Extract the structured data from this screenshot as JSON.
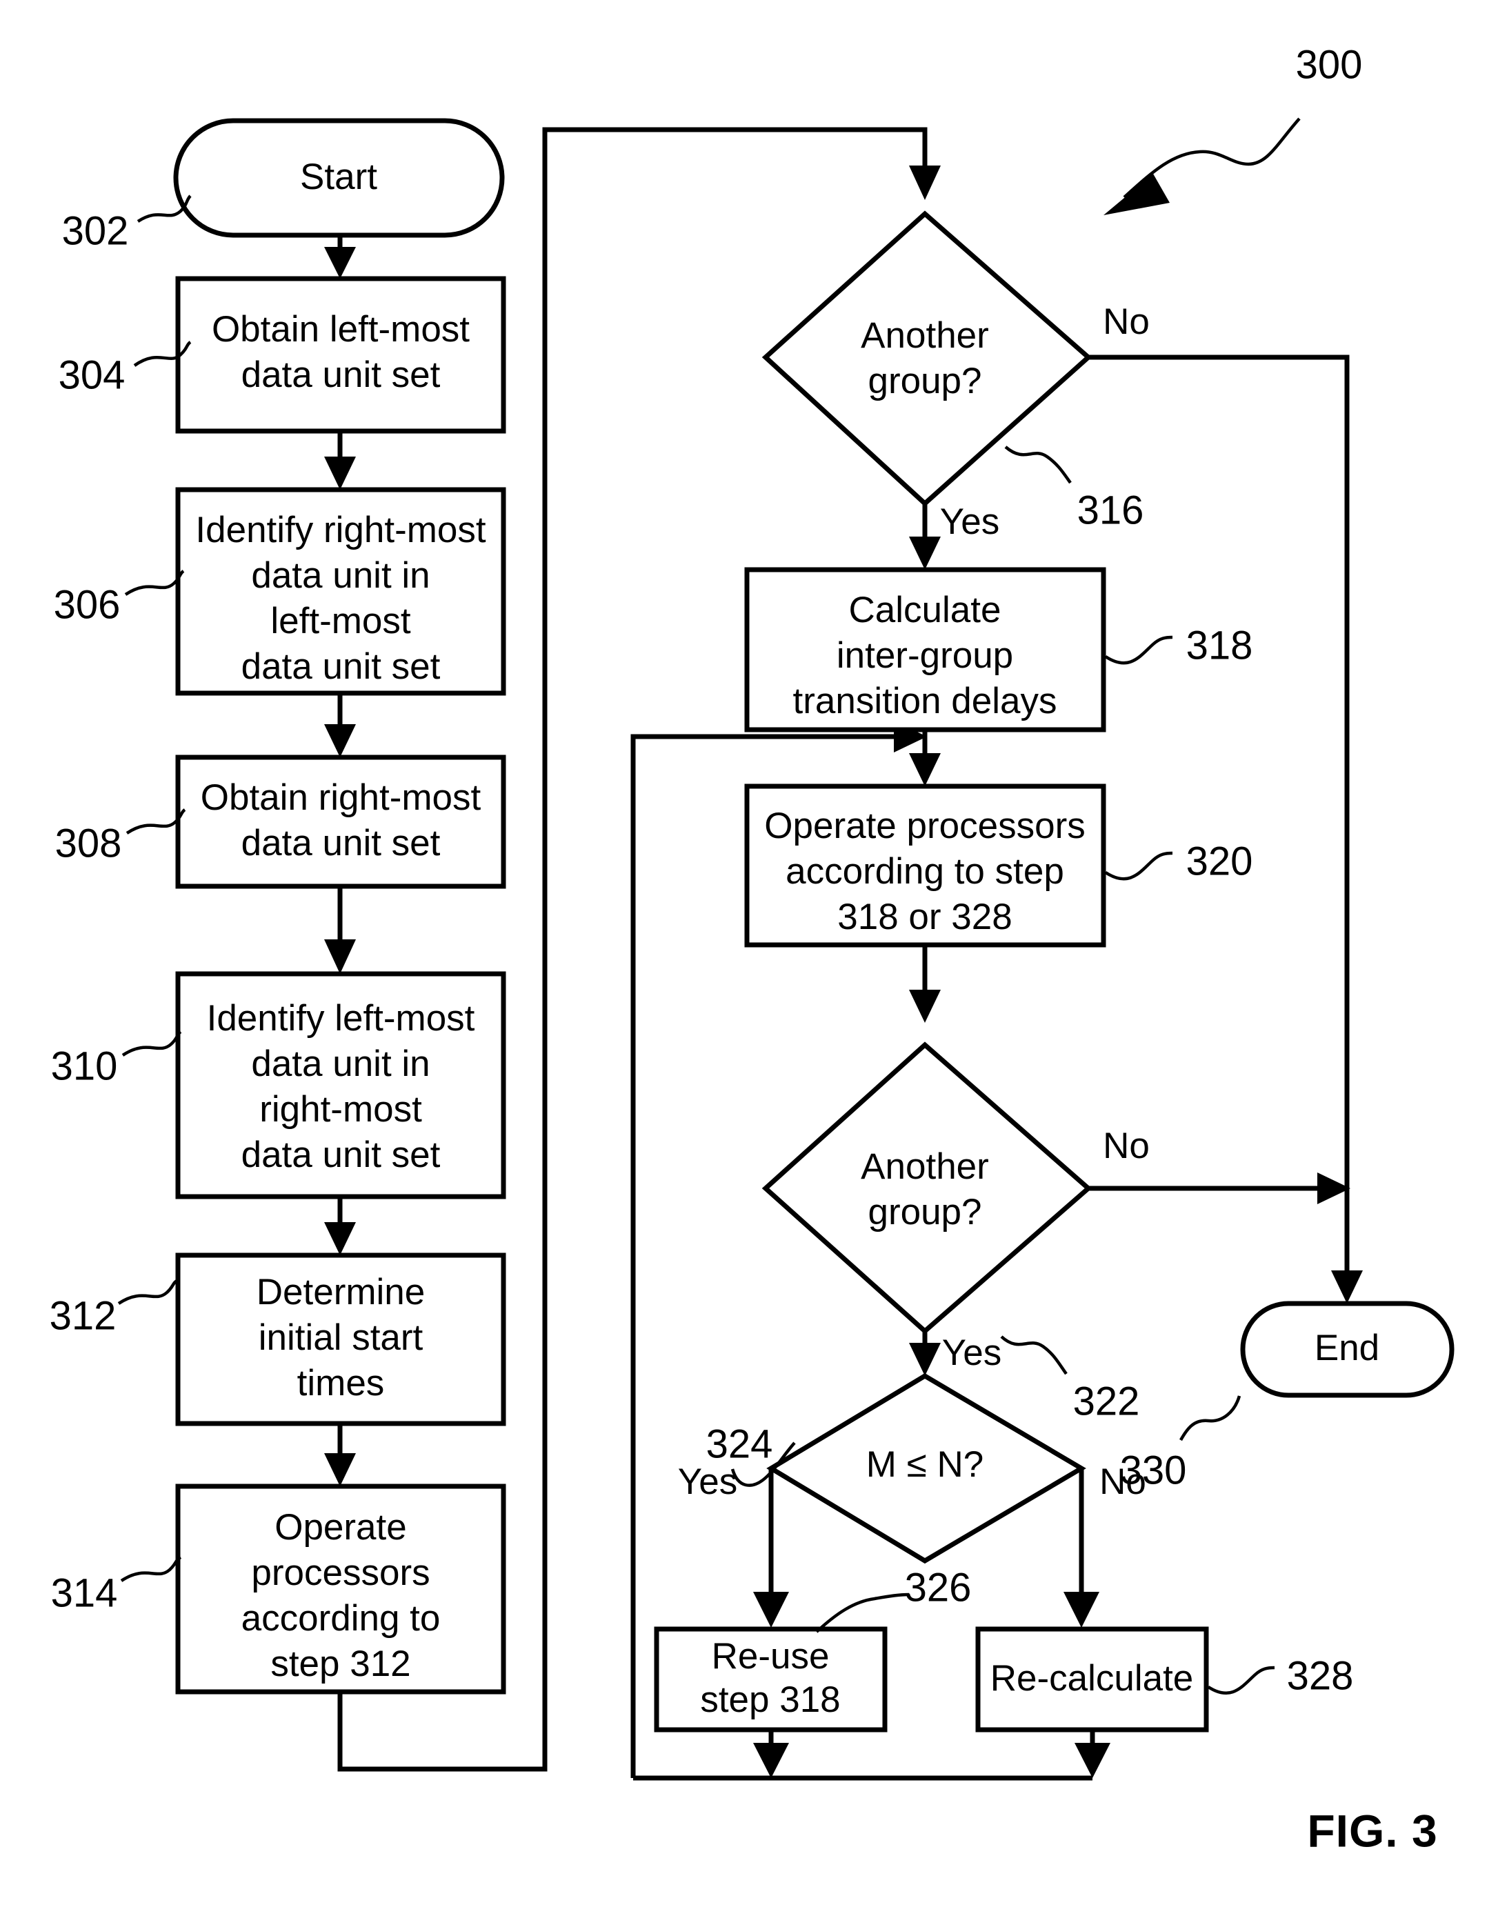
{
  "figure": {
    "label": "FIG. 3",
    "diagram_ref": "300"
  },
  "nodes": {
    "start": {
      "ref": "302",
      "label": "Start",
      "shape": "terminator"
    },
    "n304": {
      "ref": "304",
      "shape": "process",
      "lines": [
        "Obtain left-most",
        "data unit set"
      ]
    },
    "n306": {
      "ref": "306",
      "shape": "process",
      "lines": [
        "Identify right-most",
        "data unit in",
        "left-most",
        "data unit set"
      ]
    },
    "n308": {
      "ref": "308",
      "shape": "process",
      "lines": [
        "Obtain right-most",
        "data unit set"
      ]
    },
    "n310": {
      "ref": "310",
      "shape": "process",
      "lines": [
        "Identify left-most",
        "data unit in",
        "right-most",
        "data unit set"
      ]
    },
    "n312": {
      "ref": "312",
      "shape": "process",
      "lines": [
        "Determine",
        "initial start",
        "times"
      ]
    },
    "n314": {
      "ref": "314",
      "shape": "process",
      "lines": [
        "Operate",
        "processors",
        "according to",
        "step 312"
      ]
    },
    "n316": {
      "ref": "316",
      "shape": "decision",
      "lines": [
        "Another",
        "group?"
      ]
    },
    "n318": {
      "ref": "318",
      "shape": "process",
      "lines": [
        "Calculate",
        "inter-group",
        "transition delays"
      ]
    },
    "n320": {
      "ref": "320",
      "shape": "process",
      "lines": [
        "Operate processors",
        "according to step",
        "318 or 328"
      ]
    },
    "n322": {
      "ref": "322",
      "shape": "decision",
      "lines": [
        "Another",
        "group?"
      ]
    },
    "n324": {
      "ref": "324",
      "shape": "decision",
      "lines": [
        "M ≤ N?"
      ]
    },
    "n326": {
      "ref": "326",
      "shape": "process",
      "lines": [
        "Re-use",
        "step 318"
      ]
    },
    "n328": {
      "ref": "328",
      "shape": "process",
      "lines": [
        "Re-calculate"
      ]
    },
    "end": {
      "ref": "330",
      "label": "End",
      "shape": "terminator"
    }
  },
  "branch_labels": {
    "b316_no": "No",
    "b316_yes": "Yes",
    "b322_no": "No",
    "b322_yes": "Yes",
    "b324_yes": "Yes",
    "b324_no": "No"
  },
  "colors": {
    "stroke": "#000000",
    "fill": "#ffffff",
    "text": "#000000"
  }
}
